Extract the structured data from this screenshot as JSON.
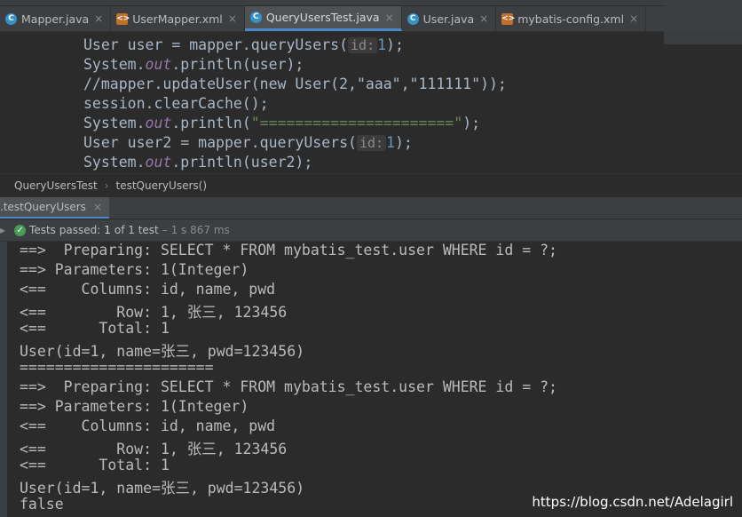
{
  "tabs": [
    {
      "label": "Mapper.java",
      "icon": "java-class-icon",
      "active": false
    },
    {
      "label": "UserMapper.xml",
      "icon": "xml-file-icon",
      "active": false
    },
    {
      "label": "QueryUsersTest.java",
      "icon": "test-class-icon",
      "active": true
    },
    {
      "label": "User.java",
      "icon": "java-class-icon",
      "active": false
    },
    {
      "label": "mybatis-config.xml",
      "icon": "xml-file-icon",
      "active": false
    }
  ],
  "editor": {
    "line1_a": "User user = mapper.queryUsers(",
    "line1_hint": "id:",
    "line1_num": "1",
    "line1_b": ");",
    "line2_a": "System.",
    "line2_out": "out",
    "line2_b": ".println(user);",
    "line3": "//mapper.updateUser(new User(2,\"aaa\",\"111111\"));",
    "line4": "session.clearCache();",
    "line5_a": "System.",
    "line5_out": "out",
    "line5_b": ".println(",
    "line5_str": "\"======================\"",
    "line5_c": ");",
    "line6_a": "User user2 = mapper.queryUsers(",
    "line6_hint": "id:",
    "line6_num": "1",
    "line6_b": ");",
    "line7_a": "System.",
    "line7_out": "out",
    "line7_b": ".println(user2);"
  },
  "breadcrumb": {
    "class_name": "QueryUsersTest",
    "method_name": "testQueryUsers()"
  },
  "run_tab": {
    "label": ".testQueryUsers",
    "close": "×"
  },
  "status": {
    "prefix": "Tests passed:",
    "count": "1",
    "suffix": "of 1 test",
    "time": "– 1 s 867 ms"
  },
  "console_lines": [
    "==>  Preparing: SELECT * FROM mybatis_test.user WHERE id = ?;",
    "==> Parameters: 1(Integer)",
    "<==    Columns: id, name, pwd",
    "<==        Row: 1, 张三, 123456",
    "<==      Total: 1",
    "User(id=1, name=张三, pwd=123456)",
    "======================",
    "==>  Preparing: SELECT * FROM mybatis_test.user WHERE id = ?;",
    "==> Parameters: 1(Integer)",
    "<==    Columns: id, name, pwd",
    "<==        Row: 1, 张三, 123456",
    "<==      Total: 1",
    "User(id=1, name=张三, pwd=123456)",
    "false"
  ],
  "watermark": "https://blog.csdn.net/Adelagirl",
  "colors": {
    "accent": "#4a88c7",
    "success": "#499c54",
    "background": "#2b2b2b"
  }
}
